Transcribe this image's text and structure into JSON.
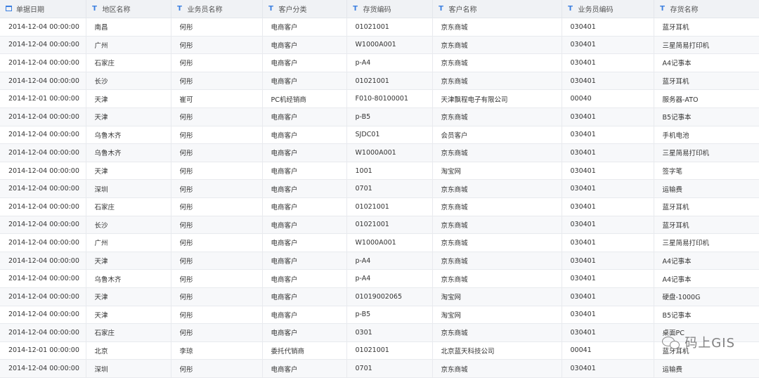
{
  "columns": [
    {
      "label": "单据日期",
      "icon": "calendar-icon"
    },
    {
      "label": "地区名称",
      "icon": "text-type-icon"
    },
    {
      "label": "业务员名称",
      "icon": "text-type-icon"
    },
    {
      "label": "客户分类",
      "icon": "text-type-icon"
    },
    {
      "label": "存货编码",
      "icon": "text-type-icon"
    },
    {
      "label": "客户名称",
      "icon": "text-type-icon"
    },
    {
      "label": "业务员编码",
      "icon": "text-type-icon"
    },
    {
      "label": "存货名称",
      "icon": "text-type-icon"
    }
  ],
  "text_type_glyph": "T",
  "rows": [
    [
      "2014-12-04 00:00:00",
      "南昌",
      "何彤",
      "电商客户",
      "01021001",
      "京东商城",
      "030401",
      "蓝牙耳机"
    ],
    [
      "2014-12-04 00:00:00",
      "广州",
      "何彤",
      "电商客户",
      "W1000A001",
      "京东商城",
      "030401",
      "三星简易打印机"
    ],
    [
      "2014-12-04 00:00:00",
      "石家庄",
      "何彤",
      "电商客户",
      "p-A4",
      "京东商城",
      "030401",
      "A4记事本"
    ],
    [
      "2014-12-04 00:00:00",
      "长沙",
      "何彤",
      "电商客户",
      "01021001",
      "京东商城",
      "030401",
      "蓝牙耳机"
    ],
    [
      "2014-12-01 00:00:00",
      "天津",
      "崔可",
      "PC机经销商",
      "F010-80100001",
      "天津飘程电子有限公司",
      "00040",
      "服务器-ATO"
    ],
    [
      "2014-12-04 00:00:00",
      "天津",
      "何彤",
      "电商客户",
      "p-B5",
      "京东商城",
      "030401",
      "B5记事本"
    ],
    [
      "2014-12-04 00:00:00",
      "乌鲁木齐",
      "何彤",
      "电商客户",
      "SJDC01",
      "会员客户",
      "030401",
      "手机电池"
    ],
    [
      "2014-12-04 00:00:00",
      "乌鲁木齐",
      "何彤",
      "电商客户",
      "W1000A001",
      "京东商城",
      "030401",
      "三星简易打印机"
    ],
    [
      "2014-12-04 00:00:00",
      "天津",
      "何彤",
      "电商客户",
      "1001",
      "淘宝网",
      "030401",
      "签字笔"
    ],
    [
      "2014-12-04 00:00:00",
      "深圳",
      "何彤",
      "电商客户",
      "0701",
      "京东商城",
      "030401",
      "运输费"
    ],
    [
      "2014-12-04 00:00:00",
      "石家庄",
      "何彤",
      "电商客户",
      "01021001",
      "京东商城",
      "030401",
      "蓝牙耳机"
    ],
    [
      "2014-12-04 00:00:00",
      "长沙",
      "何彤",
      "电商客户",
      "01021001",
      "京东商城",
      "030401",
      "蓝牙耳机"
    ],
    [
      "2014-12-04 00:00:00",
      "广州",
      "何彤",
      "电商客户",
      "W1000A001",
      "京东商城",
      "030401",
      "三星简易打印机"
    ],
    [
      "2014-12-04 00:00:00",
      "天津",
      "何彤",
      "电商客户",
      "p-A4",
      "京东商城",
      "030401",
      "A4记事本"
    ],
    [
      "2014-12-04 00:00:00",
      "乌鲁木齐",
      "何彤",
      "电商客户",
      "p-A4",
      "京东商城",
      "030401",
      "A4记事本"
    ],
    [
      "2014-12-04 00:00:00",
      "天津",
      "何彤",
      "电商客户",
      "01019002065",
      "淘宝网",
      "030401",
      "硬盘-1000G"
    ],
    [
      "2014-12-04 00:00:00",
      "天津",
      "何彤",
      "电商客户",
      "p-B5",
      "淘宝网",
      "030401",
      "B5记事本"
    ],
    [
      "2014-12-04 00:00:00",
      "石家庄",
      "何彤",
      "电商客户",
      "0301",
      "京东商城",
      "030401",
      "桌面PC"
    ],
    [
      "2014-12-01 00:00:00",
      "北京",
      "李琼",
      "委托代销商",
      "01021001",
      "北京蓝天科技公司",
      "00041",
      "蓝牙耳机"
    ],
    [
      "2014-12-04 00:00:00",
      "深圳",
      "何彤",
      "电商客户",
      "0701",
      "京东商城",
      "030401",
      "运输费"
    ]
  ],
  "watermark": {
    "text": "码上GIS",
    "icon": "wechat-icon"
  }
}
